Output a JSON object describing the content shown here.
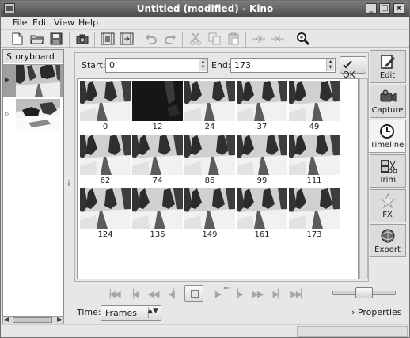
{
  "window": {
    "title": "Untitled (modified) - Kino",
    "buttons": {
      "minimize": "_",
      "maximize": "□",
      "close": "x"
    }
  },
  "menu": [
    {
      "label": "File",
      "mnemonic": "F"
    },
    {
      "label": "Edit",
      "mnemonic": "E"
    },
    {
      "label": "View",
      "mnemonic": "V"
    },
    {
      "label": "Help",
      "mnemonic": "H"
    }
  ],
  "toolbar": {
    "icons": [
      "new-icon",
      "open-icon",
      "save-icon",
      "capture-still-icon",
      "insert-before-icon",
      "insert-after-icon",
      "undo-icon",
      "redo-icon",
      "cut-icon",
      "copy-icon",
      "paste-icon",
      "split-scene-icon",
      "join-scenes-icon",
      "zoom-icon"
    ]
  },
  "storyboard": {
    "header": "Storyboard",
    "items": [
      {
        "selected": true
      },
      {
        "selected": false
      }
    ]
  },
  "range": {
    "start_label": "Start:",
    "start_value": "0",
    "end_label": "End:",
    "end_value": "173",
    "ok_label": "OK"
  },
  "frames": [
    {
      "label": "0",
      "scene": "trail"
    },
    {
      "label": "12",
      "scene": "dark"
    },
    {
      "label": "24",
      "scene": "trail"
    },
    {
      "label": "37",
      "scene": "trail"
    },
    {
      "label": "49",
      "scene": "trail"
    },
    {
      "label": "62",
      "scene": "trail"
    },
    {
      "label": "74",
      "scene": "trail"
    },
    {
      "label": "86",
      "scene": "trail"
    },
    {
      "label": "99",
      "scene": "trail"
    },
    {
      "label": "111",
      "scene": "trail"
    },
    {
      "label": "124",
      "scene": "trail"
    },
    {
      "label": "136",
      "scene": "trail"
    },
    {
      "label": "149",
      "scene": "trail"
    },
    {
      "label": "161",
      "scene": "trail"
    },
    {
      "label": "173",
      "scene": "trail"
    }
  ],
  "tabs": [
    {
      "label": "Edit",
      "icon": "edit-icon",
      "active": false
    },
    {
      "label": "Capture",
      "icon": "capture-icon",
      "active": false
    },
    {
      "label": "Timeline",
      "icon": "timeline-icon",
      "active": true
    },
    {
      "label": "Trim",
      "icon": "trim-icon",
      "active": false
    },
    {
      "label": "FX",
      "icon": "fx-icon",
      "active": false
    },
    {
      "label": "Export",
      "icon": "export-icon",
      "active": false
    }
  ],
  "transport": {
    "buttons": [
      "start-icon",
      "prev-scene-icon",
      "rewind-icon",
      "back-frame-icon",
      "stop-icon",
      "play-icon",
      "forward-frame-icon",
      "fast-forward-icon",
      "next-scene-icon",
      "end-icon"
    ]
  },
  "time": {
    "label": "Time:",
    "mnemonic": "T",
    "format": "Frames"
  },
  "properties_label": "Properties",
  "colors": {
    "window_bg": "#e7e7e5",
    "titlebar": "#5a5a5a",
    "selection": "#9e9e9c"
  }
}
